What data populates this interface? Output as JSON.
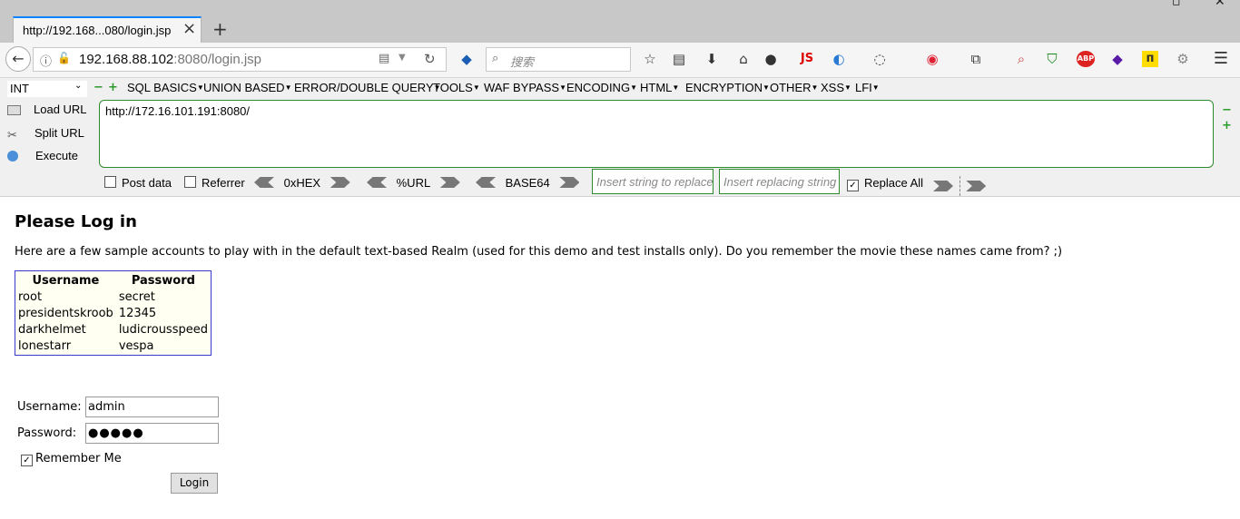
{
  "browser": {
    "tab_title": "http://192.168...080/login.jsp",
    "url_host": "192.168.88.102",
    "url_port": ":8080/login.jsp",
    "search_placeholder": "搜索",
    "js_label": "JS",
    "abp_label": "ABP"
  },
  "hackbar": {
    "select_value": "INT",
    "menus": [
      "SQL BASICS",
      "UNION BASED",
      "ERROR/DOUBLE QUERY",
      "TOOLS",
      "WAF BYPASS",
      "ENCODING",
      "HTML",
      "ENCRYPTION",
      "OTHER",
      "XSS",
      "LFI"
    ],
    "load_url": "Load URL",
    "split_url": "Split URL",
    "execute": "Execute",
    "url_value": "http://172.16.101.191:8080/",
    "post_data": "Post data",
    "referrer": "Referrer",
    "hex": "0xHEX",
    "urlenc": "%URL",
    "base64": "BASE64",
    "replace_placeholder": "Insert string to replace",
    "replacing_placeholder": "Insert replacing string",
    "replace_all": "Replace All"
  },
  "page": {
    "title": "Please Log in",
    "intro": "Here are a few sample accounts to play with in the default text-based Realm (used for this demo and test installs only). Do you remember the movie these names came from? ;)",
    "table_headers": [
      "Username",
      "Password"
    ],
    "accounts": [
      [
        "root",
        "secret"
      ],
      [
        "presidentskroob",
        "12345"
      ],
      [
        "darkhelmet",
        "ludicrousspeed"
      ],
      [
        "lonestarr",
        "vespa"
      ]
    ],
    "username_label": "Username:",
    "username_value": "admin",
    "password_label": "Password:",
    "password_value": "●●●●●",
    "remember_label": "Remember Me",
    "login_label": "Login"
  }
}
